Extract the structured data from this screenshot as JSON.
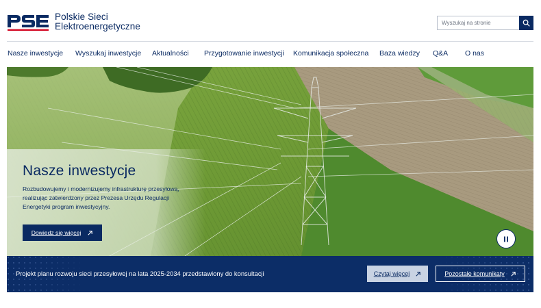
{
  "brand": {
    "logo_text": "PSE",
    "name_line1": "Polskie Sieci",
    "name_line2": "Elektroenergetyczne",
    "color_primary": "#0a2a62",
    "color_accent": "#d5132d"
  },
  "search": {
    "placeholder": "Wyszukaj na stronie",
    "value": "",
    "icon": "search-icon"
  },
  "nav": {
    "items": [
      {
        "label": "Nasze inwestycje"
      },
      {
        "label": "Wyszukaj inwestycje"
      },
      {
        "label": "Aktualności"
      },
      {
        "label": "Przygotowanie inwestycji"
      },
      {
        "label": "Komunikacja społeczna"
      },
      {
        "label": "Baza wiedzy"
      },
      {
        "label": "Q&A"
      },
      {
        "label": "O nas"
      }
    ]
  },
  "hero": {
    "title": "Nasze inwestycje",
    "description": "Rozbudowujemy i modernizujemy infrastrukturę przesyłową, realizując zatwierdzony przez Prezesa Urzędu Regulacji Energetyki program inwestycyjny.",
    "cta_label": "Dowiedz się więcej",
    "cta_icon": "arrow-up-right-icon",
    "pause_icon": "pause-icon"
  },
  "announcement": {
    "text": "Projekt planu rozwoju sieci przesyłowej na lata 2025-2034 przedstawiony do konsultacji",
    "read_more_label": "Czytaj więcej",
    "other_label": "Pozostałe komunikaty",
    "icon": "arrow-up-right-icon"
  }
}
